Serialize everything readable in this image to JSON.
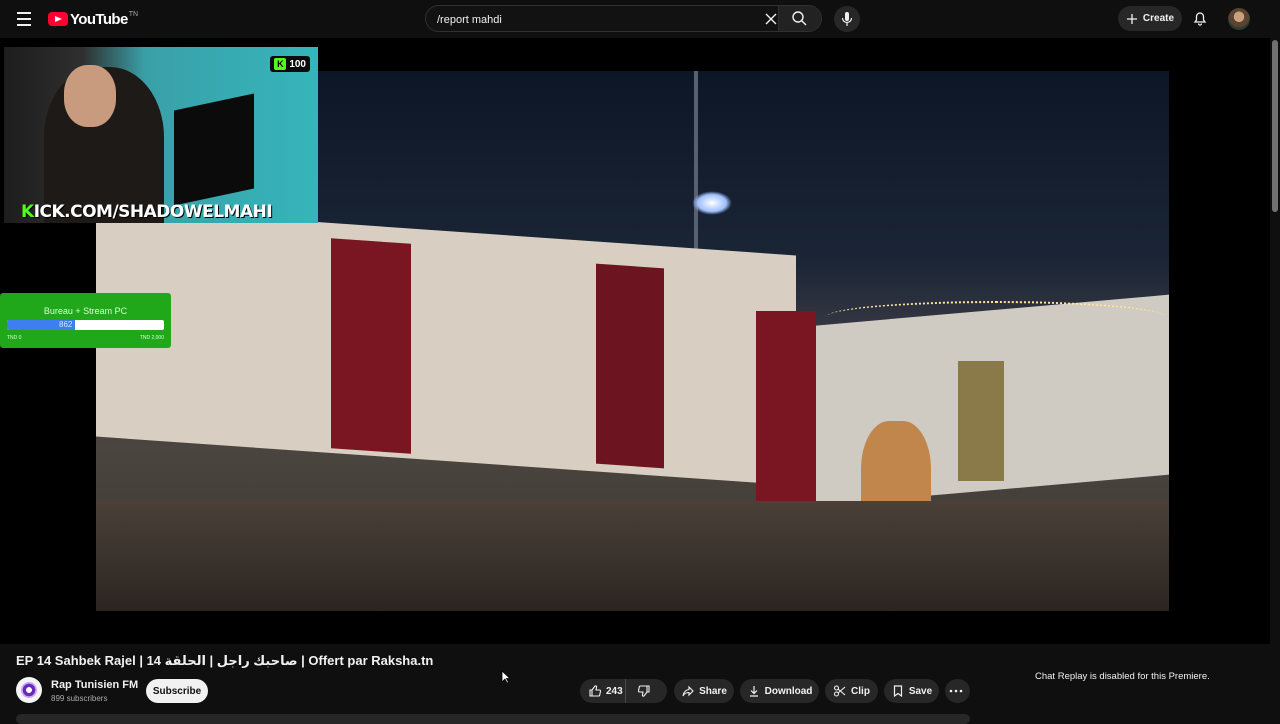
{
  "header": {
    "logo_text": "YouTube",
    "logo_tm": "TN",
    "search_value": "/report mahdi",
    "create_label": "Create"
  },
  "overlay": {
    "kick_url_prefix": "K",
    "kick_url_rest": "ICK.COM/SHADOWELMAHI",
    "kick_badge_count": "100",
    "goal_title": "Bureau + Stream PC",
    "goal_current": "862",
    "goal_min": "TND 0",
    "goal_max": "TND 2,000",
    "goal_progress_fraction": 0.43
  },
  "video": {
    "title": "EP 14 Sahbek Rajel | صاحبك راجل | الحلقة 14 | Offert par Raksha.tn",
    "channel_name": "Rap Tunisien FM",
    "subscribers": "899 subscribers",
    "subscribe_label": "Subscribe",
    "like_count": "243",
    "share_label": "Share",
    "download_label": "Download",
    "clip_label": "Clip",
    "save_label": "Save"
  },
  "chat": {
    "notice": "Chat Replay is disabled for this Premiere."
  },
  "colors": {
    "background": "#0f0f0f",
    "brand_red": "#ff0033",
    "kick_green": "#53fc18",
    "goal_green": "#21a81a",
    "goal_fill": "#3d7ff0"
  }
}
